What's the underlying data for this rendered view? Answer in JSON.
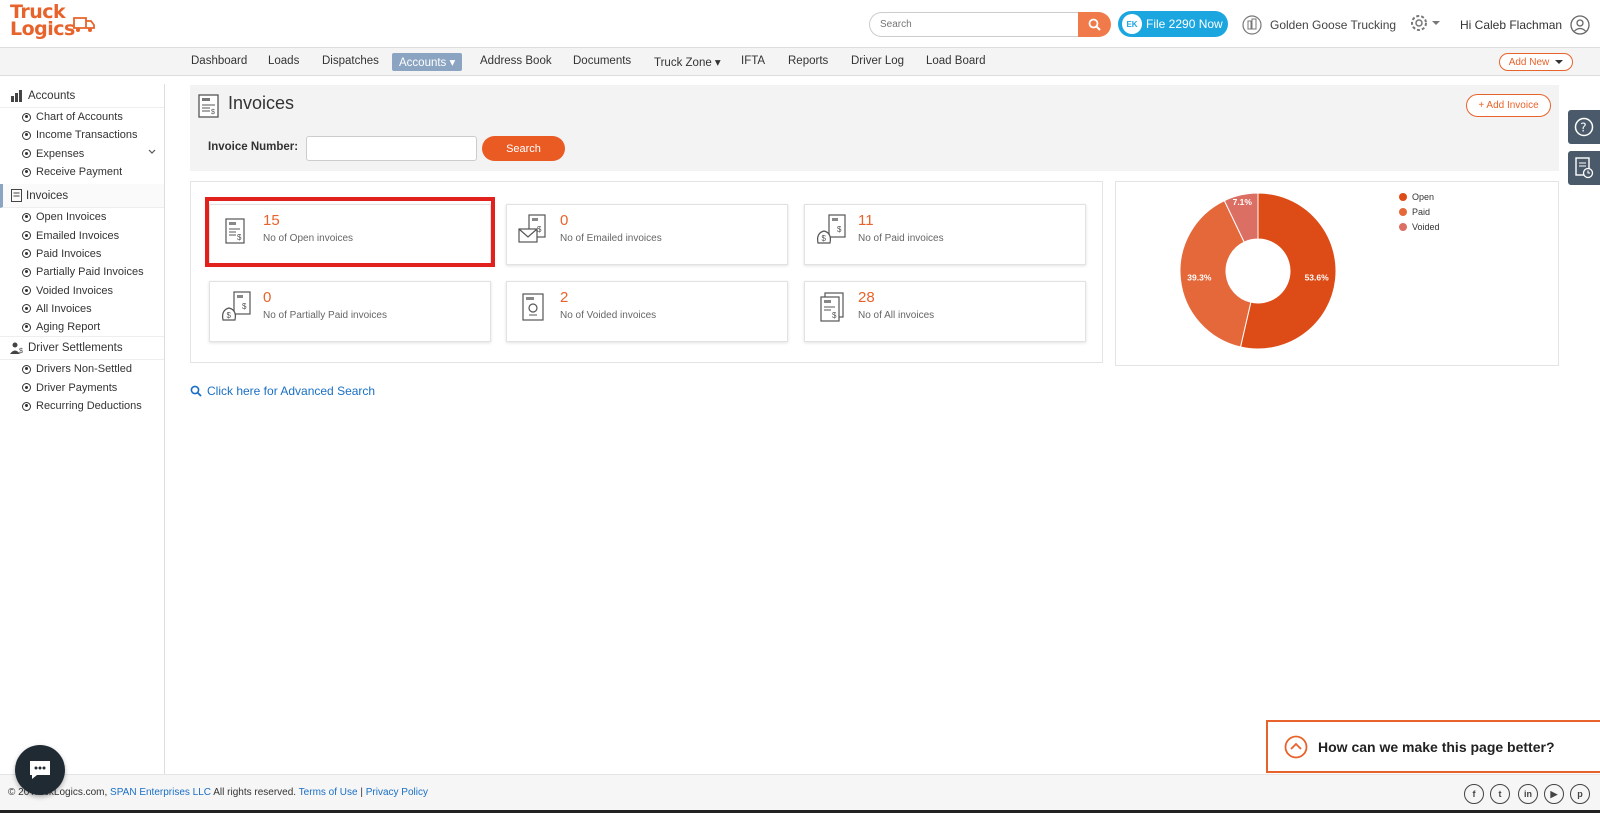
{
  "brand": {
    "logo_text_1": "Truck",
    "logo_text_2": "Logics"
  },
  "topbar": {
    "search_placeholder": "Search",
    "file2290_label": "File 2290 Now",
    "file2290_badge": "EK",
    "company_name": "Golden Goose Trucking",
    "greeting": "Hi Caleb Flachman"
  },
  "nav": {
    "items": [
      "Dashboard",
      "Loads",
      "Dispatches",
      "Accounts ▾",
      "Address Book",
      "Documents",
      "Truck Zone ▾",
      "IFTA",
      "Reports",
      "Driver Log",
      "Load Board"
    ],
    "add_new": "Add New"
  },
  "sidebar": {
    "accounts_header": "Accounts",
    "accounts_items": [
      "Chart of Accounts",
      "Income Transactions",
      "Expenses",
      "Receive Payment"
    ],
    "invoices_header": "Invoices",
    "invoices_items": [
      "Open Invoices",
      "Emailed Invoices",
      "Paid Invoices",
      "Partially Paid Invoices",
      "Voided Invoices",
      "All Invoices",
      "Aging Report"
    ],
    "drivers_header": "Driver Settlements",
    "drivers_items": [
      "Drivers Non-Settled",
      "Driver Payments",
      "Recurring Deductions"
    ]
  },
  "page": {
    "title": "Invoices",
    "add_invoice": "+ Add Invoice",
    "invoice_number_label": "Invoice Number:",
    "search_button": "Search",
    "advanced_search": "Click here for Advanced Search"
  },
  "cards": [
    {
      "count": "15",
      "label": "No of Open invoices"
    },
    {
      "count": "0",
      "label": "No of Emailed invoices"
    },
    {
      "count": "11",
      "label": "No of Paid invoices"
    },
    {
      "count": "0",
      "label": "No of Partially Paid invoices"
    },
    {
      "count": "2",
      "label": "No of Voided invoices"
    },
    {
      "count": "28",
      "label": "No of All invoices"
    }
  ],
  "chart_data": {
    "type": "pie",
    "title": "",
    "categories": [
      "Open",
      "Paid",
      "Voided"
    ],
    "values": [
      53.6,
      39.3,
      7.1
    ],
    "data_labels": [
      "53.6%",
      "39.3%",
      "7.1%"
    ],
    "colors": [
      "#dd4b16",
      "#e4683a",
      "#dc6f63"
    ],
    "legend_position": "top-right",
    "donut": true
  },
  "feedback": {
    "label": "How can we make this page better?"
  },
  "footer": {
    "copyright_prefix": "© 20",
    "copyright_mid": "TruckLogics.com,",
    "company_link": "SPAN Enterprises LLC",
    "rights": "All rights reserved.",
    "terms": "Terms of Use",
    "separator": "|",
    "privacy": "Privacy Policy"
  },
  "colors": {
    "accent": "#e8632b",
    "nav_active": "#8aa4c2",
    "link": "#1a6fc4",
    "highlight": "#e2201c"
  }
}
